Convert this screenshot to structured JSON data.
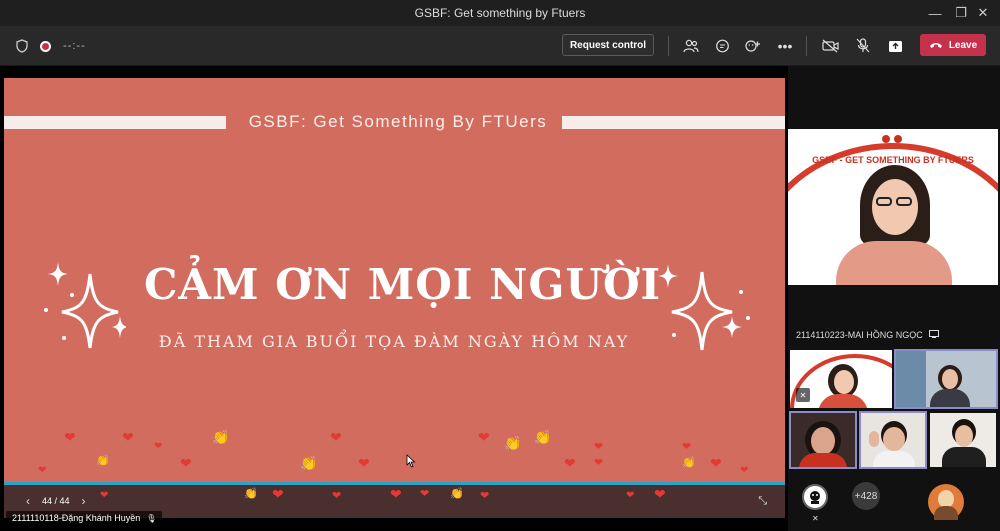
{
  "window": {
    "title": "GSBF: Get something by Ftuers",
    "minimize_glyph": "—",
    "maximize_glyph": "❐",
    "close_glyph": "✕"
  },
  "toolbar": {
    "timer": "--:--",
    "request_control_label": "Request control",
    "leave_label": "Leave",
    "icons": [
      "shield-icon",
      "record-icon",
      "participants-icon",
      "chat-icon",
      "reactions-icon",
      "more-icon",
      "camera-off-icon",
      "mic-off-icon",
      "share-icon",
      "phone-icon"
    ],
    "more_glyph": "•••"
  },
  "slide": {
    "header": "GSBF: Get Something By FTUers",
    "main_text": "CẢM ƠN MỌI NGƯỜI",
    "sub_text": "ĐÃ THAM GIA BUỔI TỌA ĐÀM NGÀY HÔM NAY",
    "background_color": "#d16c5e",
    "page_indicator": "44 / 44",
    "prev_glyph": "‹",
    "next_glyph": "›",
    "collapse_glyph": "⤡"
  },
  "presenter": {
    "name": "2111110118-Đặng Khánh Huyền",
    "mic_glyph": "🎙"
  },
  "featured_participant": {
    "name": "2114110223-MAI HỒNG NGỌC",
    "banner_title": "GSBF - GET SOMETHING BY FTUERS"
  },
  "overflow": {
    "count": "+428"
  },
  "colors": {
    "accent": "#c4314b",
    "tile_border": "#8b8cc7",
    "slide_accent_line": "#2aa3c6"
  }
}
